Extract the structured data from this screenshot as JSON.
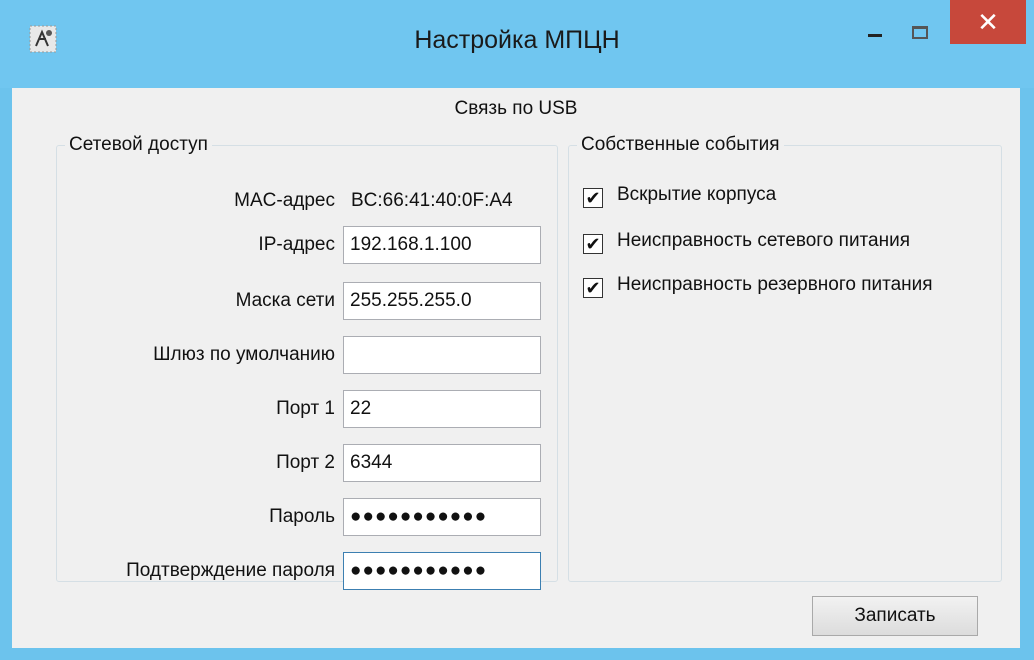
{
  "window": {
    "title": "Настройка МПЦН",
    "close_glyph": "✕",
    "icons": {
      "app": "app-icon",
      "minimize": "minimize-icon",
      "maximize": "maximize-icon",
      "close": "close-icon"
    },
    "colors": {
      "titlebar": "#70c6f0",
      "close": "#c7483b",
      "client": "#f0f0f0"
    }
  },
  "usb_label": "Связь по USB",
  "network": {
    "legend": "Сетевой доступ",
    "mac_label": "MAC-адрес",
    "mac_value": "BC:66:41:40:0F:A4",
    "ip_label": "IP-адрес",
    "ip_value": "192.168.1.100",
    "mask_label": "Маска сети",
    "mask_value": "255.255.255.0",
    "gateway_label": "Шлюз по умолчанию",
    "gateway_value": "",
    "port1_label": "Порт 1",
    "port1_value": "22",
    "port2_label": "Порт 2",
    "port2_value": "6344",
    "password_label": "Пароль",
    "password_value": "●●●●●●●●●●●",
    "confirm_label": "Подтверждение пароля",
    "confirm_value": "●●●●●●●●●●●"
  },
  "events": {
    "legend": "Собственные события",
    "items": [
      {
        "label": "Вскрытие корпуса",
        "checked": true
      },
      {
        "label": "Неисправность сетевого питания",
        "checked": true
      },
      {
        "label": "Неисправность резервного питания",
        "checked": true
      }
    ],
    "check_glyph": "✔"
  },
  "write_button": "Записать"
}
